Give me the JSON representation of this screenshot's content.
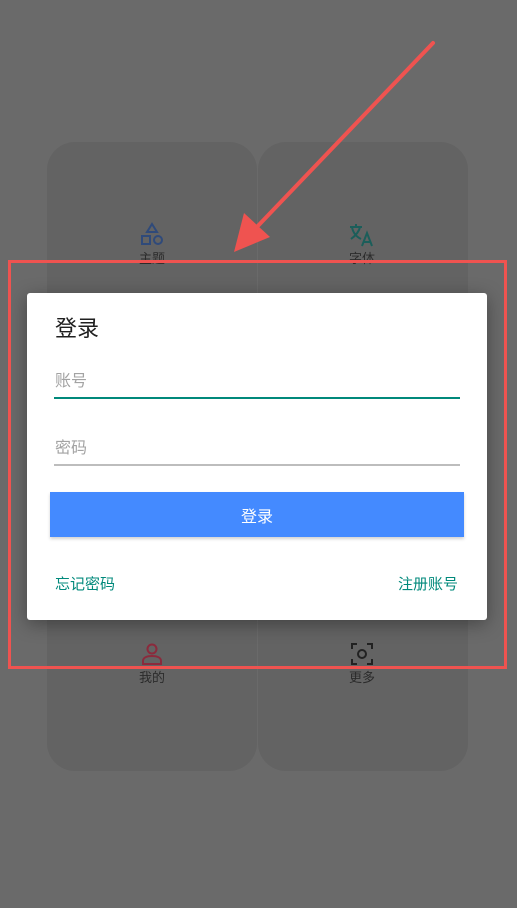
{
  "background": {
    "items": [
      {
        "id": "theme",
        "label": "主题",
        "icon": "shapes-icon"
      },
      {
        "id": "font",
        "label": "字体",
        "icon": "translate-icon"
      },
      {
        "id": "mine",
        "label": "我的",
        "icon": "person-icon"
      },
      {
        "id": "more",
        "label": "更多",
        "icon": "scan-icon"
      }
    ]
  },
  "dialog": {
    "title": "登录",
    "account_placeholder": "账号",
    "account_value": "",
    "password_placeholder": "密码",
    "password_value": "",
    "login_label": "登录",
    "forgot_label": "忘记密码",
    "register_label": "注册账号"
  },
  "colors": {
    "accent_teal": "#00897b",
    "button_blue": "#448aff",
    "annotation_red": "#ef5350",
    "scrim": "#6a6a6a"
  }
}
